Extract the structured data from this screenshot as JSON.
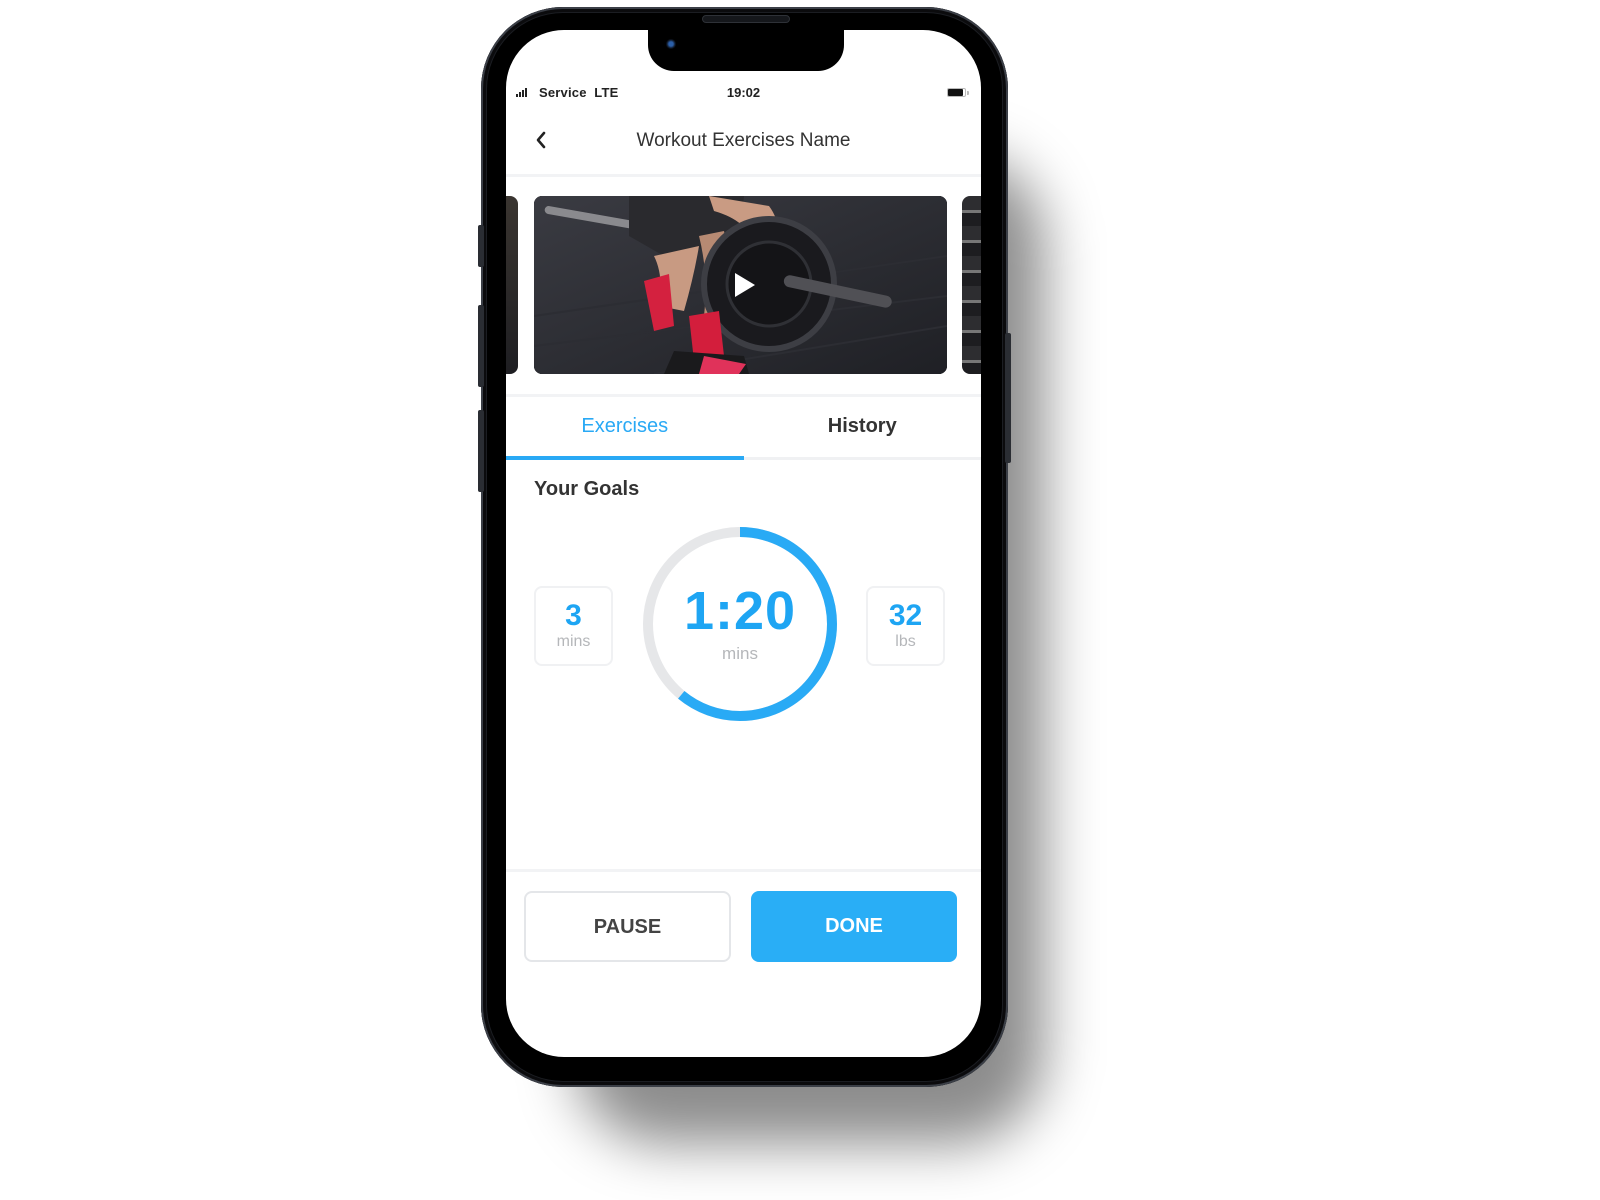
{
  "status_bar": {
    "carrier": "Service",
    "network": "LTE",
    "time": "19:02",
    "signal_icon": "signal-bars-icon",
    "battery_icon": "battery-icon"
  },
  "header": {
    "back_icon": "chevron-left-icon",
    "title": "Workout Exercises Name"
  },
  "media": {
    "video_description": "Person lifting a barbell plate in gym, red socks",
    "play_icon": "play-icon"
  },
  "tabs": [
    {
      "label": "Exercises",
      "active": true
    },
    {
      "label": "History",
      "active": false
    }
  ],
  "goals": {
    "section_label": "Your Goals",
    "left_stat": {
      "value": "3",
      "unit": "mins"
    },
    "timer": {
      "value": "1:20",
      "unit": "mins",
      "progress_fraction": 0.61
    },
    "right_stat": {
      "value": "32",
      "unit": "lbs"
    }
  },
  "actions": {
    "pause_label": "PAUSE",
    "done_label": "DONE"
  },
  "colors": {
    "accent": "#29aaf5",
    "ring_track": "#e6e7e9",
    "text_primary": "#333333",
    "text_muted": "#b5b7ba"
  }
}
